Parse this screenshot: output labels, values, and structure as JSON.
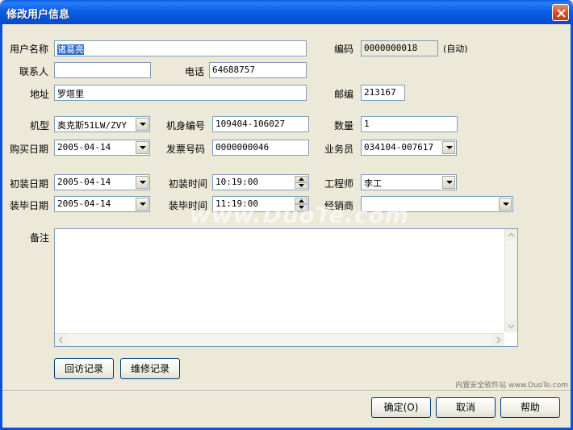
{
  "window": {
    "title": "修改用户信息"
  },
  "labels": {
    "username": "用户名称",
    "contact": "联系人",
    "address": "地址",
    "code": "编码",
    "phone": "电话",
    "postcode": "邮编",
    "model": "机型",
    "serial": "机身编号",
    "quantity": "数量",
    "purchase_date": "购买日期",
    "invoice": "发票号码",
    "salesman": "业务员",
    "install_date": "初装日期",
    "install_time": "初装时间",
    "engineer": "工程师",
    "finish_date": "装毕日期",
    "finish_time": "装毕时间",
    "dealer": "经销商",
    "remark": "备注",
    "auto": "(自动)"
  },
  "values": {
    "username": "诸葛亮",
    "contact": "",
    "address": "罗塔里",
    "code": "0000000018",
    "phone": "64688757",
    "postcode": "213167",
    "model": "奥克斯51LW/ZVY",
    "serial": "109404-106027",
    "quantity": "1",
    "purchase_date": "2005-04-14",
    "invoice": "0000000046",
    "salesman": "034104-007617",
    "install_date": "2005-04-14",
    "install_time": "10:19:00",
    "engineer": "李工",
    "finish_date": "2005-04-14",
    "finish_time": "11:19:00",
    "dealer": "",
    "remark": ""
  },
  "buttons": {
    "visit_record": "回访记录",
    "repair_record": "维修记录",
    "ok": "确定(O)",
    "cancel": "取消",
    "help": "帮助"
  },
  "watermark": {
    "main": "www.DuoTe.com",
    "corner": "内置安全软件站 www.DuoTe.com"
  },
  "colors": {
    "titlebar": "#0752d8",
    "close": "#d54a25",
    "selection": "#316ac5"
  }
}
